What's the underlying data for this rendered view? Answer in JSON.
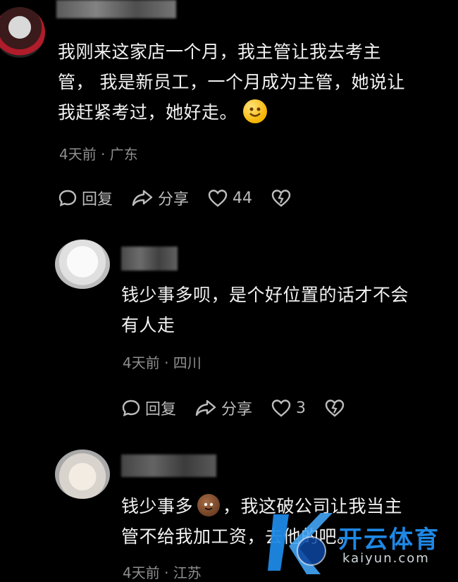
{
  "comments": [
    {
      "text_lines": [
        "我刚来这家店一个月，我主管让我去考主",
        "管， 我是新员工，一个月成为主管，她说让",
        "我赶紧考过，她好走。"
      ],
      "meta": "4天前 · 广东",
      "reply_label": "回复",
      "share_label": "分享",
      "likes": "44"
    },
    {
      "text_lines": [
        "钱少事多呗，是个好位置的话才不会",
        "有人走"
      ],
      "meta": "4天前 · 四川",
      "reply_label": "回复",
      "share_label": "分享",
      "likes": "3"
    },
    {
      "text_line1_a": "钱少事多",
      "text_line1_b": "，我这破公司让我当主",
      "text_line2": "管不给我加工资，去他的吧。",
      "meta": "4天前 · 江苏"
    }
  ],
  "watermark": {
    "brand_cn": "开云体育",
    "brand_en": "kaiyun.com"
  },
  "colors": {
    "background": "#000000",
    "text": "#f2f2f2",
    "meta": "#8f8f8f",
    "icon": "#bdbdbd",
    "watermark": "#1e88e5"
  }
}
